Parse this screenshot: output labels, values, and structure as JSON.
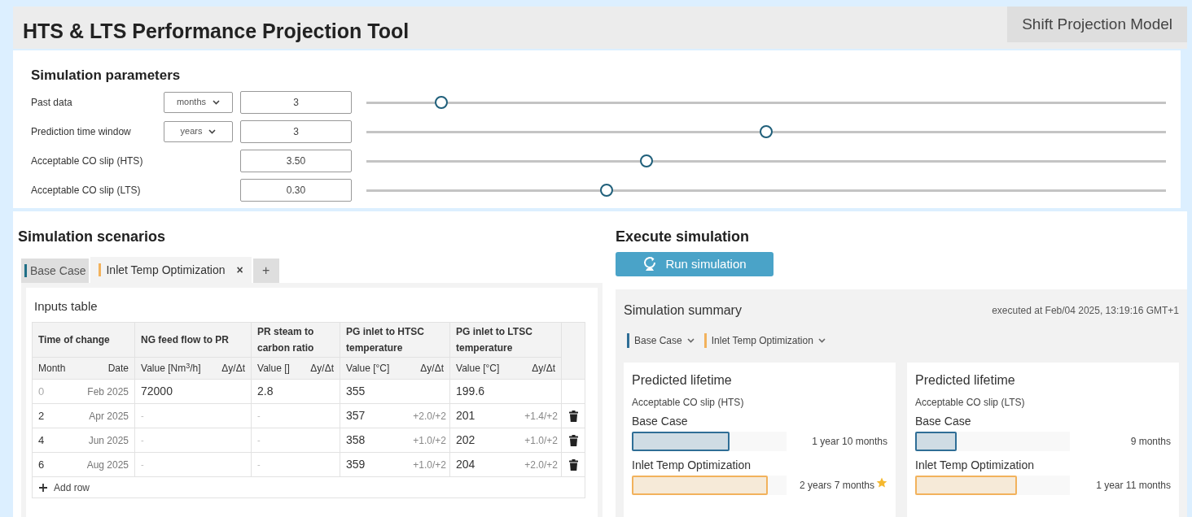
{
  "header": {
    "title": "HTS & LTS Performance Projection Tool",
    "badge": "Shift Projection Model"
  },
  "parameters": {
    "title": "Simulation parameters",
    "rows": [
      {
        "label": "Past data",
        "unit": "months",
        "value": "3",
        "level": 0.094
      },
      {
        "label": "Prediction time window",
        "unit": "years",
        "value": "3",
        "level": 0.5
      },
      {
        "label": "Acceptable CO slip (HTS)",
        "value": "3.50",
        "level": 0.35
      },
      {
        "label": "Acceptable CO slip (LTS)",
        "value": "0.30",
        "level": 0.3
      }
    ]
  },
  "scenarios": {
    "title": "Simulation scenarios",
    "tabs": [
      {
        "label": "Base Case",
        "color": "#1f6f86",
        "selected": false
      },
      {
        "label": "Inlet Temp Optimization",
        "color": "#f2b25c",
        "selected": true,
        "close": "×"
      }
    ],
    "add_tab": "+",
    "inputs_table": {
      "title": "Inputs table",
      "groups": [
        {
          "label": "Time of change",
          "columns": [
            "Month",
            "Date"
          ]
        },
        {
          "label": "NG feed flow to PR",
          "columns": [
            "Value [Nm$^{3}$/h]",
            "Δy/Δt"
          ]
        },
        {
          "label": "PR steam to carbon ratio",
          "columns": [
            "Value []",
            "Δy/Δt"
          ]
        },
        {
          "label": "PG inlet to HTSC temperature",
          "columns": [
            "Value [°C]",
            "Δy/Δt"
          ]
        },
        {
          "label": "PG inlet to LTSC temperature",
          "columns": [
            "Value [°C]",
            "Δy/Δt"
          ]
        }
      ],
      "rows": [
        {
          "month": "0",
          "date": "Feb 2025",
          "deletable": false,
          "cells": [
            {
              "value": "72000"
            },
            {
              "value": "2.8"
            },
            {
              "value": "355"
            },
            {
              "value": "199.6"
            }
          ]
        },
        {
          "month": "2",
          "date": "Apr 2025",
          "deletable": true,
          "cells": [
            {
              "placeholder": "-"
            },
            {
              "placeholder": "-"
            },
            {
              "value": "357",
              "delta": "+2.0/+2"
            },
            {
              "value": "201",
              "delta": "+1.4/+2"
            }
          ]
        },
        {
          "month": "4",
          "date": "Jun 2025",
          "deletable": true,
          "cells": [
            {
              "placeholder": "-"
            },
            {
              "placeholder": "-"
            },
            {
              "value": "358",
              "delta": "+1.0/+2"
            },
            {
              "value": "202",
              "delta": "+1.0/+2"
            }
          ]
        },
        {
          "month": "6",
          "date": "Aug 2025",
          "deletable": true,
          "cells": [
            {
              "placeholder": "-"
            },
            {
              "placeholder": "-"
            },
            {
              "value": "359",
              "delta": "+1.0/+2"
            },
            {
              "value": "204",
              "delta": "+2.0/+2"
            }
          ]
        }
      ],
      "add_row": "Add row"
    }
  },
  "execute": {
    "title": "Execute simulation",
    "button": "Run simulation"
  },
  "summary": {
    "title": "Simulation summary",
    "executed": "executed at Feb/04 2025, 13:19:16 GMT+1",
    "legend": [
      {
        "label": "Base Case",
        "color": "#2f6e96"
      },
      {
        "label": "Inlet Temp Optimization",
        "color": "#f2b25c"
      }
    ],
    "cards": [
      {
        "title": "Predicted lifetime",
        "subtitle": "Acceptable CO slip (HTS)",
        "bars": [
          {
            "label": "Base Case",
            "value": "1 year 10 months",
            "level": 0.63,
            "color": "#2f6e96",
            "star": false
          },
          {
            "label": "Inlet Temp Optimization",
            "value": "2 years 7 months",
            "level": 0.88,
            "color": "#f2b25c",
            "star": true
          }
        ]
      },
      {
        "title": "Predicted lifetime",
        "subtitle": "Acceptable CO slip (LTS)",
        "bars": [
          {
            "label": "Base Case",
            "value": "9 months",
            "level": 0.27,
            "color": "#2f6e96",
            "star": false
          },
          {
            "label": "Inlet Temp Optimization",
            "value": "1 year 11 months",
            "level": 0.66,
            "color": "#f2b25c",
            "star": false
          }
        ]
      }
    ]
  }
}
